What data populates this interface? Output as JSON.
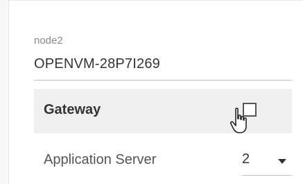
{
  "node": {
    "label": "node2",
    "value": "OPENVM-28P7I269"
  },
  "gateway": {
    "label": "Gateway",
    "checked": false
  },
  "application_server": {
    "label": "Application Server",
    "value": "2"
  },
  "icons": {
    "cursor": "hand-pointer-icon",
    "dropdown": "chevron-down-icon"
  },
  "colors": {
    "row_highlight": "#efefef",
    "text": "#333333",
    "muted_text": "#8a8a8a"
  }
}
